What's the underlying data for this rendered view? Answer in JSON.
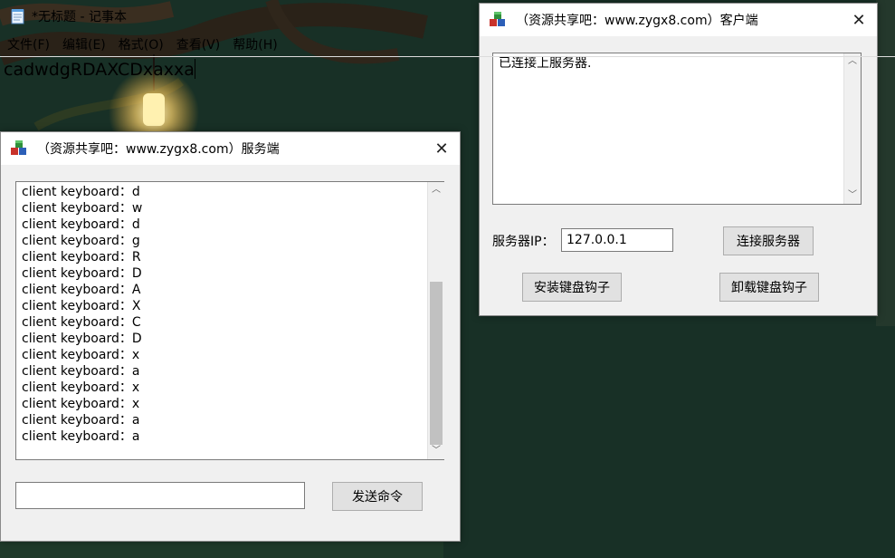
{
  "server_window": {
    "title": "（资源共享吧：www.zygx8.com）服务端",
    "close_label": "✕",
    "log_lines": [
      "client keyboard：d",
      "client keyboard：w",
      "client keyboard：d",
      "client keyboard：g",
      "client keyboard：R",
      "client keyboard：D",
      "client keyboard：A",
      "client keyboard：X",
      "client keyboard：C",
      "client keyboard：D",
      "client keyboard：x",
      "client keyboard：a",
      "client keyboard：x",
      "client keyboard：x",
      "client keyboard：a",
      "client keyboard：a"
    ],
    "command_input_value": "",
    "send_button_label": "发送命令"
  },
  "client_window": {
    "title": "（资源共享吧：www.zygx8.com）客户端",
    "close_label": "✕",
    "status_text": "已连接上服务器.",
    "server_ip_label": "服务器IP：",
    "server_ip_value": "127.0.0.1",
    "connect_button_label": "连接服务器",
    "install_hook_button_label": "安装键盘钩子",
    "uninstall_hook_button_label": "卸载键盘钩子"
  },
  "notepad": {
    "title": "*无标题 - 记事本",
    "menu": [
      "文件(F)",
      "编辑(E)",
      "格式(O)",
      "查看(V)",
      "帮助(H)"
    ],
    "content": "cadwdgRDAXCDxaxxa"
  },
  "icons": {
    "app_icon": "colored-cubes-icon",
    "notepad_icon": "notepad-icon",
    "close_icon": "close-icon",
    "scroll_up": "chevron-up-icon",
    "scroll_down": "chevron-down-icon"
  },
  "colors": {
    "window_bg": "#f0f0f0",
    "titlebar_bg": "#ffffff",
    "button_bg": "#e1e1e1",
    "button_border": "#adadad",
    "scroll_thumb": "#c1c1c1"
  }
}
